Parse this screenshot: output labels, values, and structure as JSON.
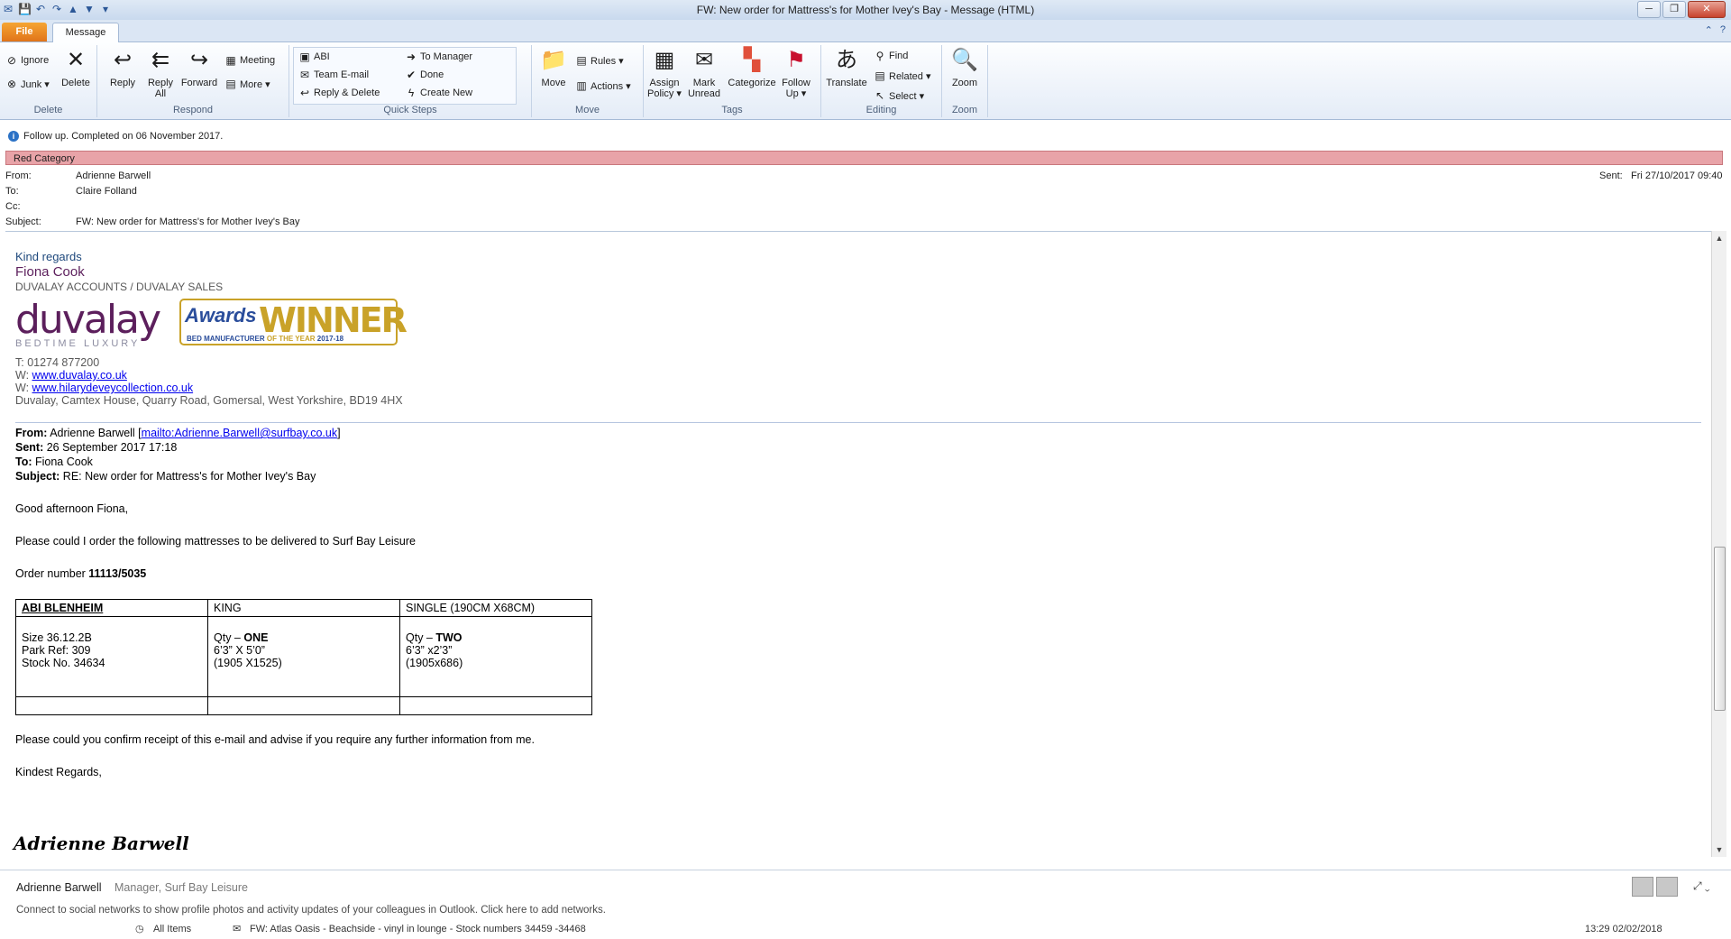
{
  "window": {
    "title": "FW: New order for Mattress's for Mother Ivey's Bay  -  Message (HTML)",
    "buttons": {
      "minimize": "─",
      "restore": "❐",
      "close": "✕"
    }
  },
  "tabs": {
    "file": "File",
    "message": "Message"
  },
  "ribbon": {
    "delete_group": {
      "label": "Delete",
      "ignore": "Ignore",
      "junk": "Junk ▾",
      "delete": "Delete"
    },
    "respond_group": {
      "label": "Respond",
      "reply": "Reply",
      "reply_all_1": "Reply",
      "reply_all_2": "All",
      "forward": "Forward",
      "meeting": "Meeting",
      "more": "More ▾"
    },
    "quicksteps_group": {
      "label": "Quick Steps",
      "items": [
        "ABI",
        "To Manager",
        "Team E-mail",
        "Done",
        "Reply & Delete",
        "Create New"
      ]
    },
    "move_group": {
      "label": "Move",
      "move": "Move",
      "rules": "Rules ▾",
      "actions": "Actions ▾"
    },
    "tags_group": {
      "label": "Tags",
      "assign_1": "Assign",
      "assign_2": "Policy ▾",
      "mark_1": "Mark",
      "mark_2": "Unread",
      "categorize": "Categorize",
      "follow_1": "Follow",
      "follow_2": "Up ▾"
    },
    "editing_group": {
      "label": "Editing",
      "translate": "Translate",
      "find": "Find",
      "related": "Related ▾",
      "select": "Select ▾"
    },
    "zoom_group": {
      "label": "Zoom",
      "zoom": "Zoom"
    }
  },
  "info_bar": "Follow up.  Completed on 06 November 2017.",
  "category_bar": "Red Category",
  "header": {
    "from_label": "From:",
    "from": "Adrienne Barwell",
    "to_label": "To:",
    "to": "Claire Folland",
    "cc_label": "Cc:",
    "cc": "",
    "subject_label": "Subject:",
    "subject": "FW: New order for Mattress's for Mother Ivey's Bay",
    "sent_label": "Sent:",
    "sent": "Fri 27/10/2017 09:40"
  },
  "signature": {
    "regards": "Kind regards",
    "name": "Fiona Cook",
    "dept": "DUVALAY ACCOUNTS / DUVALAY SALES",
    "logo_word": "duvalay",
    "logo_tag": "BEDTIME LUXURY",
    "award_awards": "Awards",
    "award_winner": "WINNER",
    "award_sub_a": "BED MANUFACTURER",
    "award_sub_b": " OF THE YEAR ",
    "award_sub_c": "2017-18",
    "phone": "T: 01274 877200",
    "w_prefix": "W: ",
    "web1": "www.duvalay.co.uk",
    "web2": "www.hilarydeveycollection.co.uk",
    "address": "Duvalay, Camtex House, Quarry Road, Gomersal, West Yorkshire, BD19 4HX"
  },
  "forwarded": {
    "from_label": "From:",
    "from_name": " Adrienne Barwell [",
    "from_link": "mailto:Adrienne.Barwell@surfbay.co.uk",
    "from_close": "]",
    "sent_label": "Sent:",
    "sent": " 26 September 2017 17:18",
    "to_label": "To:",
    "to": " Fiona Cook",
    "subject_label": "Subject:",
    "subject": " RE: New order for Mattress's for Mother Ivey's Bay"
  },
  "message": {
    "greeting": "Good afternoon Fiona,",
    "line1": "Please could I order the following mattresses to be delivered to Surf Bay Leisure",
    "order_label": "Order number ",
    "order_number": "11113/5035",
    "table": {
      "h1": "ABI BLENHEIM",
      "h2": "KING",
      "h3": "SINGLE (190CM X68CM)",
      "c1": [
        "Size 36.12.2B",
        "Park Ref: 309",
        "Stock No. 34634"
      ],
      "c2_qty_label": "Qty – ",
      "c2_qty": "ONE",
      "c2": [
        "6’3” X 5’0”",
        "(1905 X1525)"
      ],
      "c3_qty_label": "Qty – ",
      "c3_qty": "TWO",
      "c3": [
        "6’3” x2’3”",
        "(1905x686)"
      ]
    },
    "confirm": "Please could you confirm receipt of this e-mail and advise if you require any further information from me.",
    "closing": "Kindest Regards,",
    "handwritten": "Adrienne Barwell"
  },
  "people_pane": {
    "name": "Adrienne Barwell",
    "role": "Manager, Surf Bay Leisure",
    "connect": "Connect to social networks to show profile photos and activity updates of your colleagues in Outlook. Click here to add networks."
  },
  "status_bar": {
    "all_items": "All Items",
    "next_item": "FW: Atlas Oasis - Beachside - vinyl in lounge - Stock numbers 34459 -34468",
    "time": "13:29 02/02/2018"
  }
}
